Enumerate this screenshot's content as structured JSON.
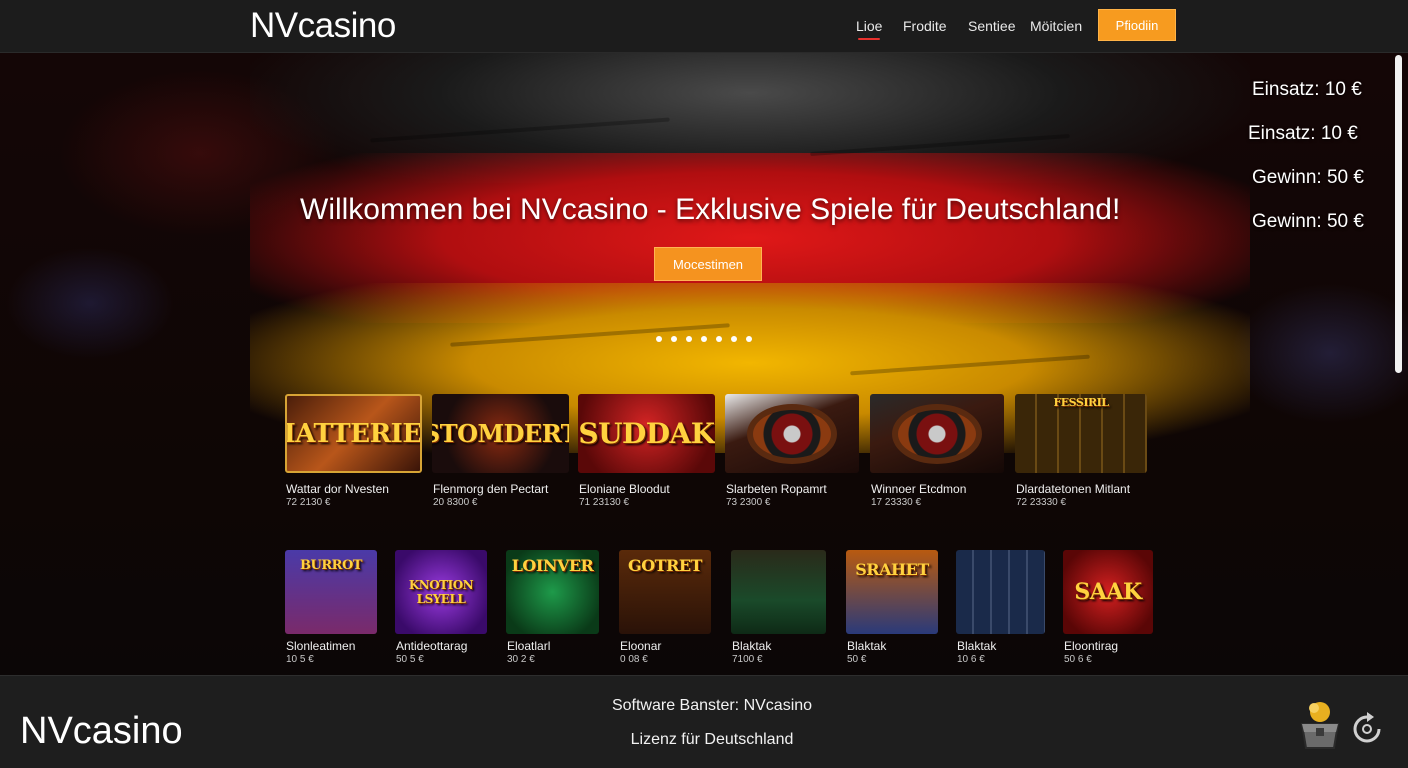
{
  "header": {
    "logo": "NVcasino",
    "nav": [
      "Lioe",
      "Frodite",
      "Sentiee",
      "Möitcien"
    ],
    "active_nav": "Lioe",
    "button_label": "Pfiodiin"
  },
  "hero": {
    "headline": "Willkommen bei NVcasino - Exklusive Spiele für Deutschland!",
    "cta_label": "Mocestimen",
    "slide_count": 7,
    "stats": [
      "Einsatz: 10 €",
      "Einsatz: 10 €",
      "Gewinn: 50 €",
      "Gewinn: 50 €"
    ]
  },
  "games_row1": [
    {
      "title": "BIATTERIEN",
      "name": "Wattar dor Nvesten",
      "price": "72 2130 €"
    },
    {
      "title": "STOMDERT",
      "name": "Flenmorg den Pectart",
      "price": "20 8300 €"
    },
    {
      "title": "SUDDAK",
      "name": "Eloniane Bloodut",
      "price": "71 23130 €"
    },
    {
      "title": "",
      "name": "Slarbeten Ropamrt",
      "price": "73 2300 €"
    },
    {
      "title": "",
      "name": "Winnoer Etcdmon",
      "price": "17 23330 €"
    },
    {
      "title": "FESSIRIL",
      "name": "Dlardatetonen Mitlant",
      "price": "72 23330 €"
    }
  ],
  "games_row2": [
    {
      "title": "BURROT",
      "name": "Slonleatimen",
      "price": "10 5 €"
    },
    {
      "title": "KNOTION LSYELL",
      "name": "Antideottarag",
      "price": "50 5 €"
    },
    {
      "title": "LOINVER",
      "name": "Eloatlarl",
      "price": "30 2 €"
    },
    {
      "title": "GOTRET",
      "name": "Eloonar",
      "price": "0 08 €"
    },
    {
      "title": "",
      "name": "Blaktak",
      "price": "7100 €"
    },
    {
      "title": "SRAHET",
      "name": "Blaktak",
      "price": "50 €"
    },
    {
      "title": "",
      "name": "Blaktak",
      "price": "10 6 €"
    },
    {
      "title": "SAAK",
      "name": "Eloontirag",
      "price": "50 6 €"
    }
  ],
  "footer": {
    "logo": "NVcasino",
    "line1": "Software Banster: NVcasino",
    "line2": "Lizenz für Deutschland"
  },
  "colors": {
    "accent_orange": "#f5931f",
    "nav_underline": "#e8312d",
    "flag_red": "#d81414",
    "flag_gold": "#f2b600"
  },
  "icons": [
    "chest-icon",
    "reload-icon"
  ]
}
